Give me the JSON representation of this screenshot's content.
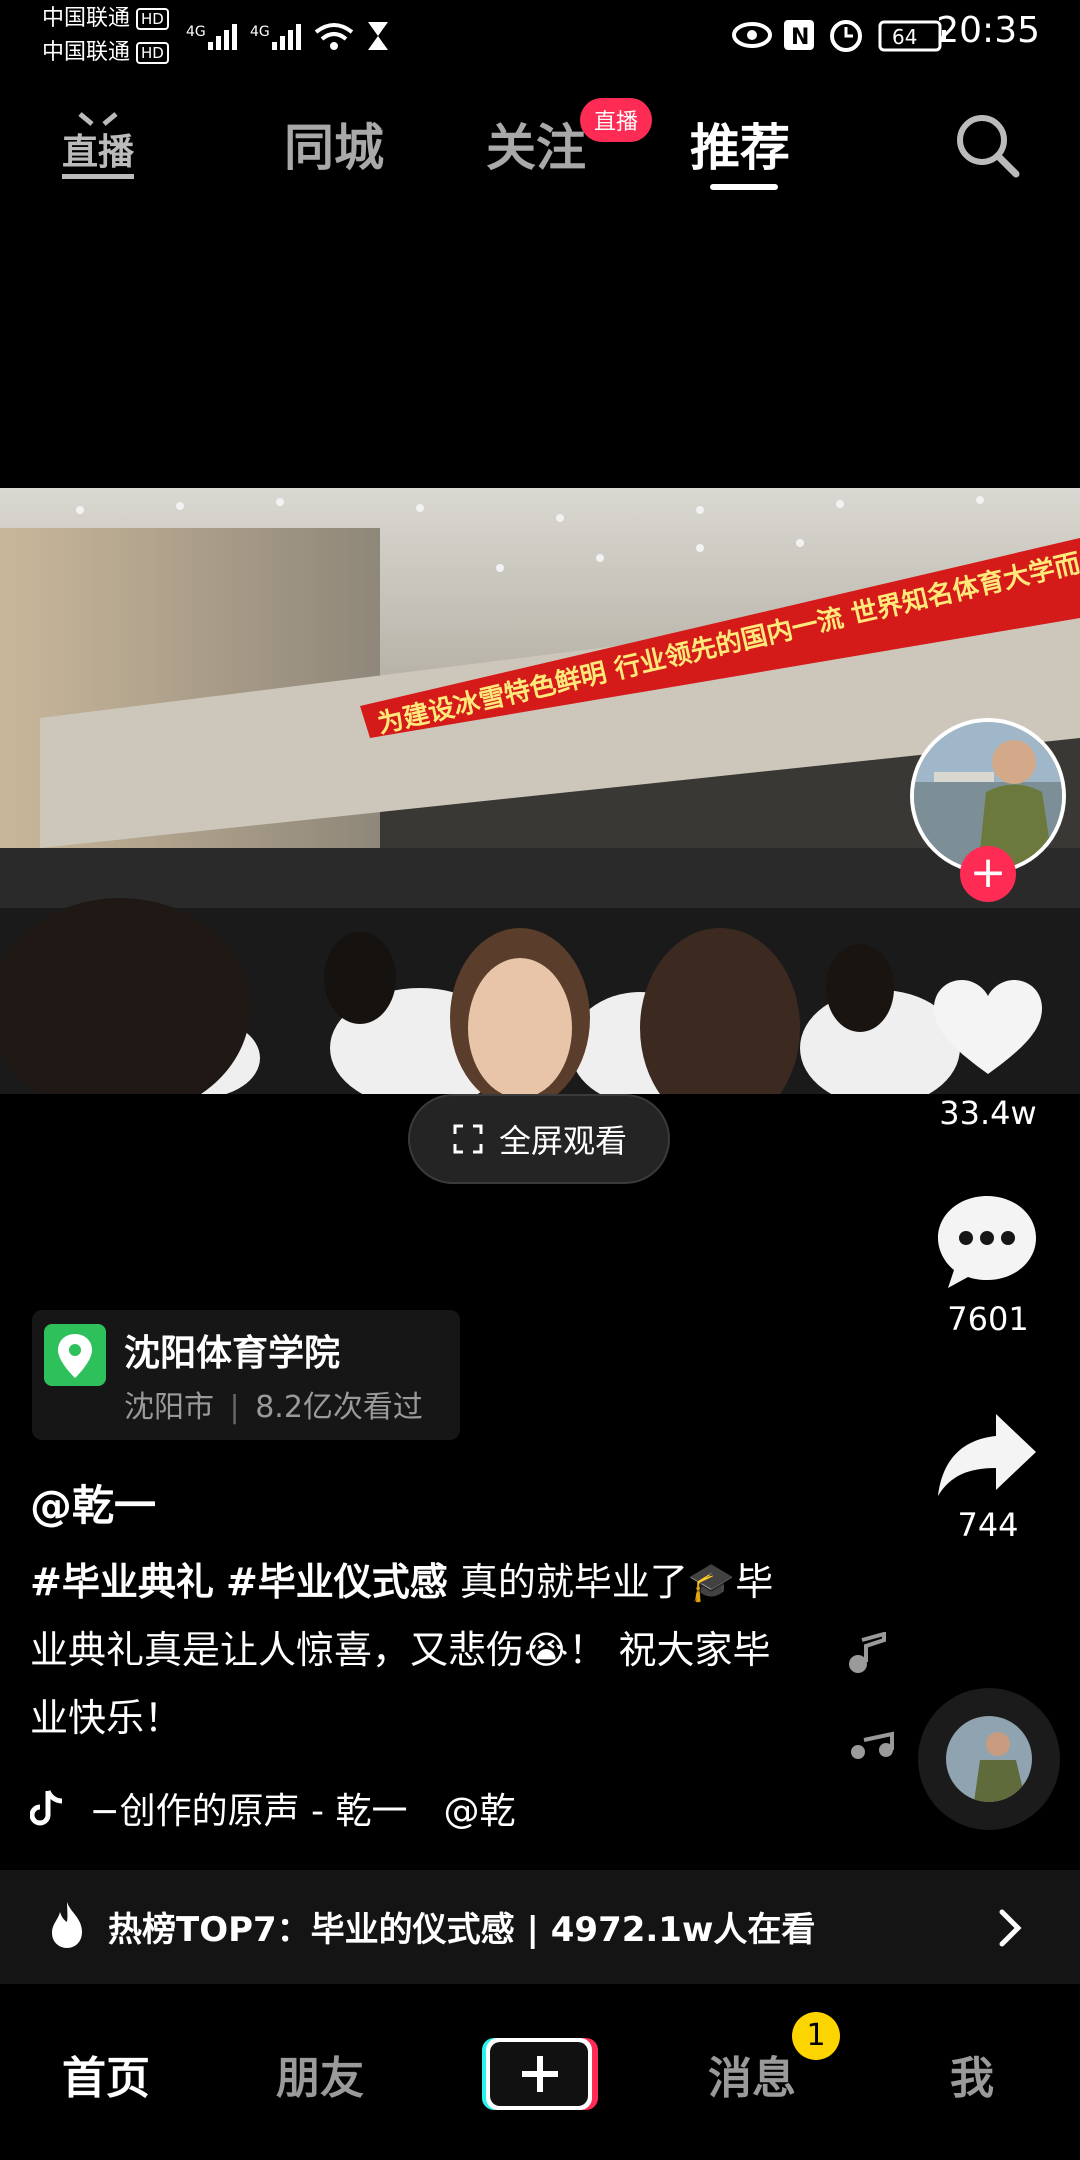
{
  "status_bar": {
    "carrier1": "中国联通",
    "carrier2": "中国联通",
    "hd": "HD",
    "battery": "64",
    "time": "20:35"
  },
  "top_nav": {
    "tabs": [
      "同城",
      "关注",
      "推荐"
    ],
    "active_tab": "推荐",
    "live_label": "直播",
    "live_badge": "直播"
  },
  "video": {
    "banner_text": "为建设冰雪特色鲜明 行业领先的国内一流 世界知名体育大学而"
  },
  "fullscreen_label": "全屏观看",
  "actions": {
    "likes": "33.4w",
    "comments": "7601",
    "shares": "744"
  },
  "location": {
    "name": "沈阳体育学院",
    "city": "沈阳市",
    "views": "8.2亿次看过"
  },
  "author": "@乾一",
  "caption": {
    "tag1": "#毕业典礼",
    "tag2": "#毕业仪式感",
    "text_a": " 真的就毕业了",
    "emoji1": "🎓",
    "text_b": "毕业典礼真是让人惊喜，又悲伤",
    "emoji2": "😭",
    "text_c": "！ 祝大家毕业快乐！"
  },
  "music": "−创作的原声 - 乾一　@乾",
  "hot": {
    "text": "热榜TOP7：毕业的仪式感 | 4972.1w人在看"
  },
  "bottom_nav": {
    "home": "首页",
    "friends": "朋友",
    "messages": "消息",
    "me": "我",
    "message_badge": "1"
  },
  "colors": {
    "accent": "#fe2c55",
    "badge": "#fcd500",
    "location_pin": "#2ec15b"
  }
}
